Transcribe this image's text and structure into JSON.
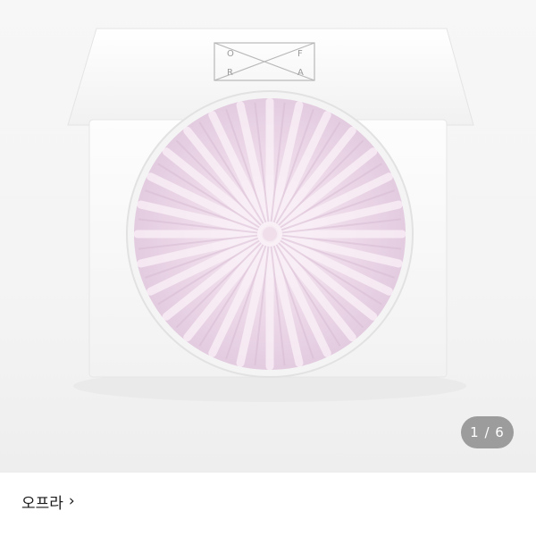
{
  "product": {
    "logo_letters": [
      "O",
      "F",
      "R",
      "A"
    ],
    "highlighter_color": "#efd9ea",
    "case_color": "#ffffff"
  },
  "gallery": {
    "current": "1",
    "separator": "/",
    "total": "6",
    "counter_text": "1 / 6"
  },
  "seller": {
    "brand_label": "오프라",
    "chevron": "›"
  }
}
